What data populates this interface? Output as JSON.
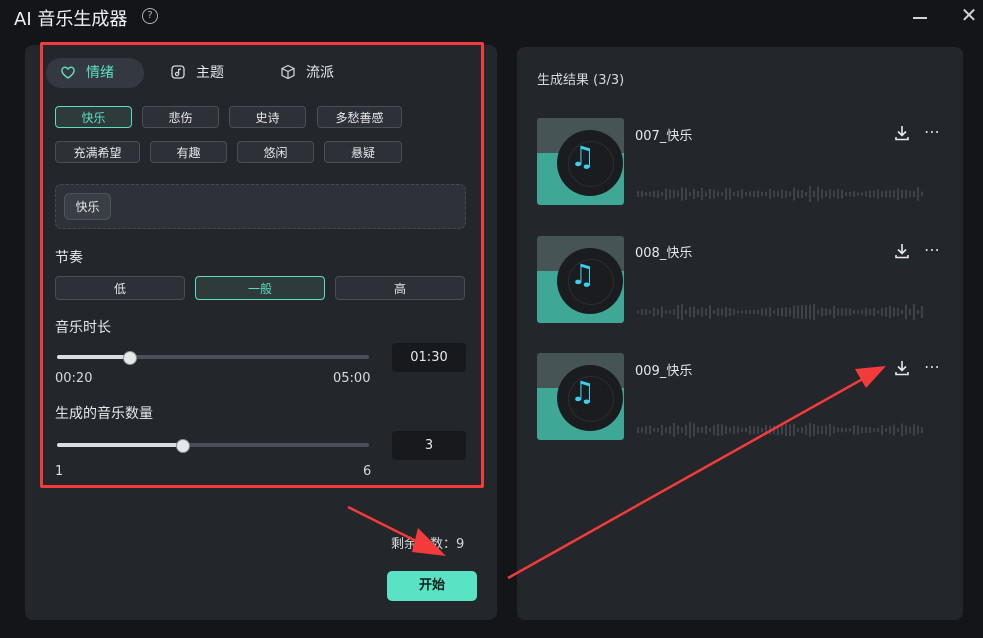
{
  "window": {
    "title": "AI 音乐生成器"
  },
  "tabs": [
    {
      "label": "情绪",
      "icon": "heart-icon"
    },
    {
      "label": "主题",
      "icon": "music-folder-icon"
    },
    {
      "label": "流派",
      "icon": "cube-icon"
    }
  ],
  "moods": [
    "快乐",
    "悲伤",
    "史诗",
    "多愁善感",
    "充满希望",
    "有趣",
    "悠闲",
    "悬疑"
  ],
  "selected_tag": "快乐",
  "tempo": {
    "label": "节奏",
    "options": [
      "低",
      "一般",
      "高"
    ],
    "selected": "一般"
  },
  "duration": {
    "label": "音乐时长",
    "min": "00:20",
    "max": "05:00",
    "value": "01:30",
    "level": 0.23
  },
  "count": {
    "label": "生成的音乐数量",
    "min": "1",
    "max": "6",
    "value": "3",
    "level": 0.4
  },
  "remaining": "剩余次数：9",
  "start_label": "开始",
  "results": {
    "title": "生成结果 (3/3)",
    "items": [
      {
        "name": "007_快乐"
      },
      {
        "name": "008_快乐"
      },
      {
        "name": "009_快乐"
      }
    ]
  },
  "colors": {
    "accent": "#5ce0c2",
    "annotation": "#f43b3b",
    "thumb_teal": "#3fa795"
  }
}
